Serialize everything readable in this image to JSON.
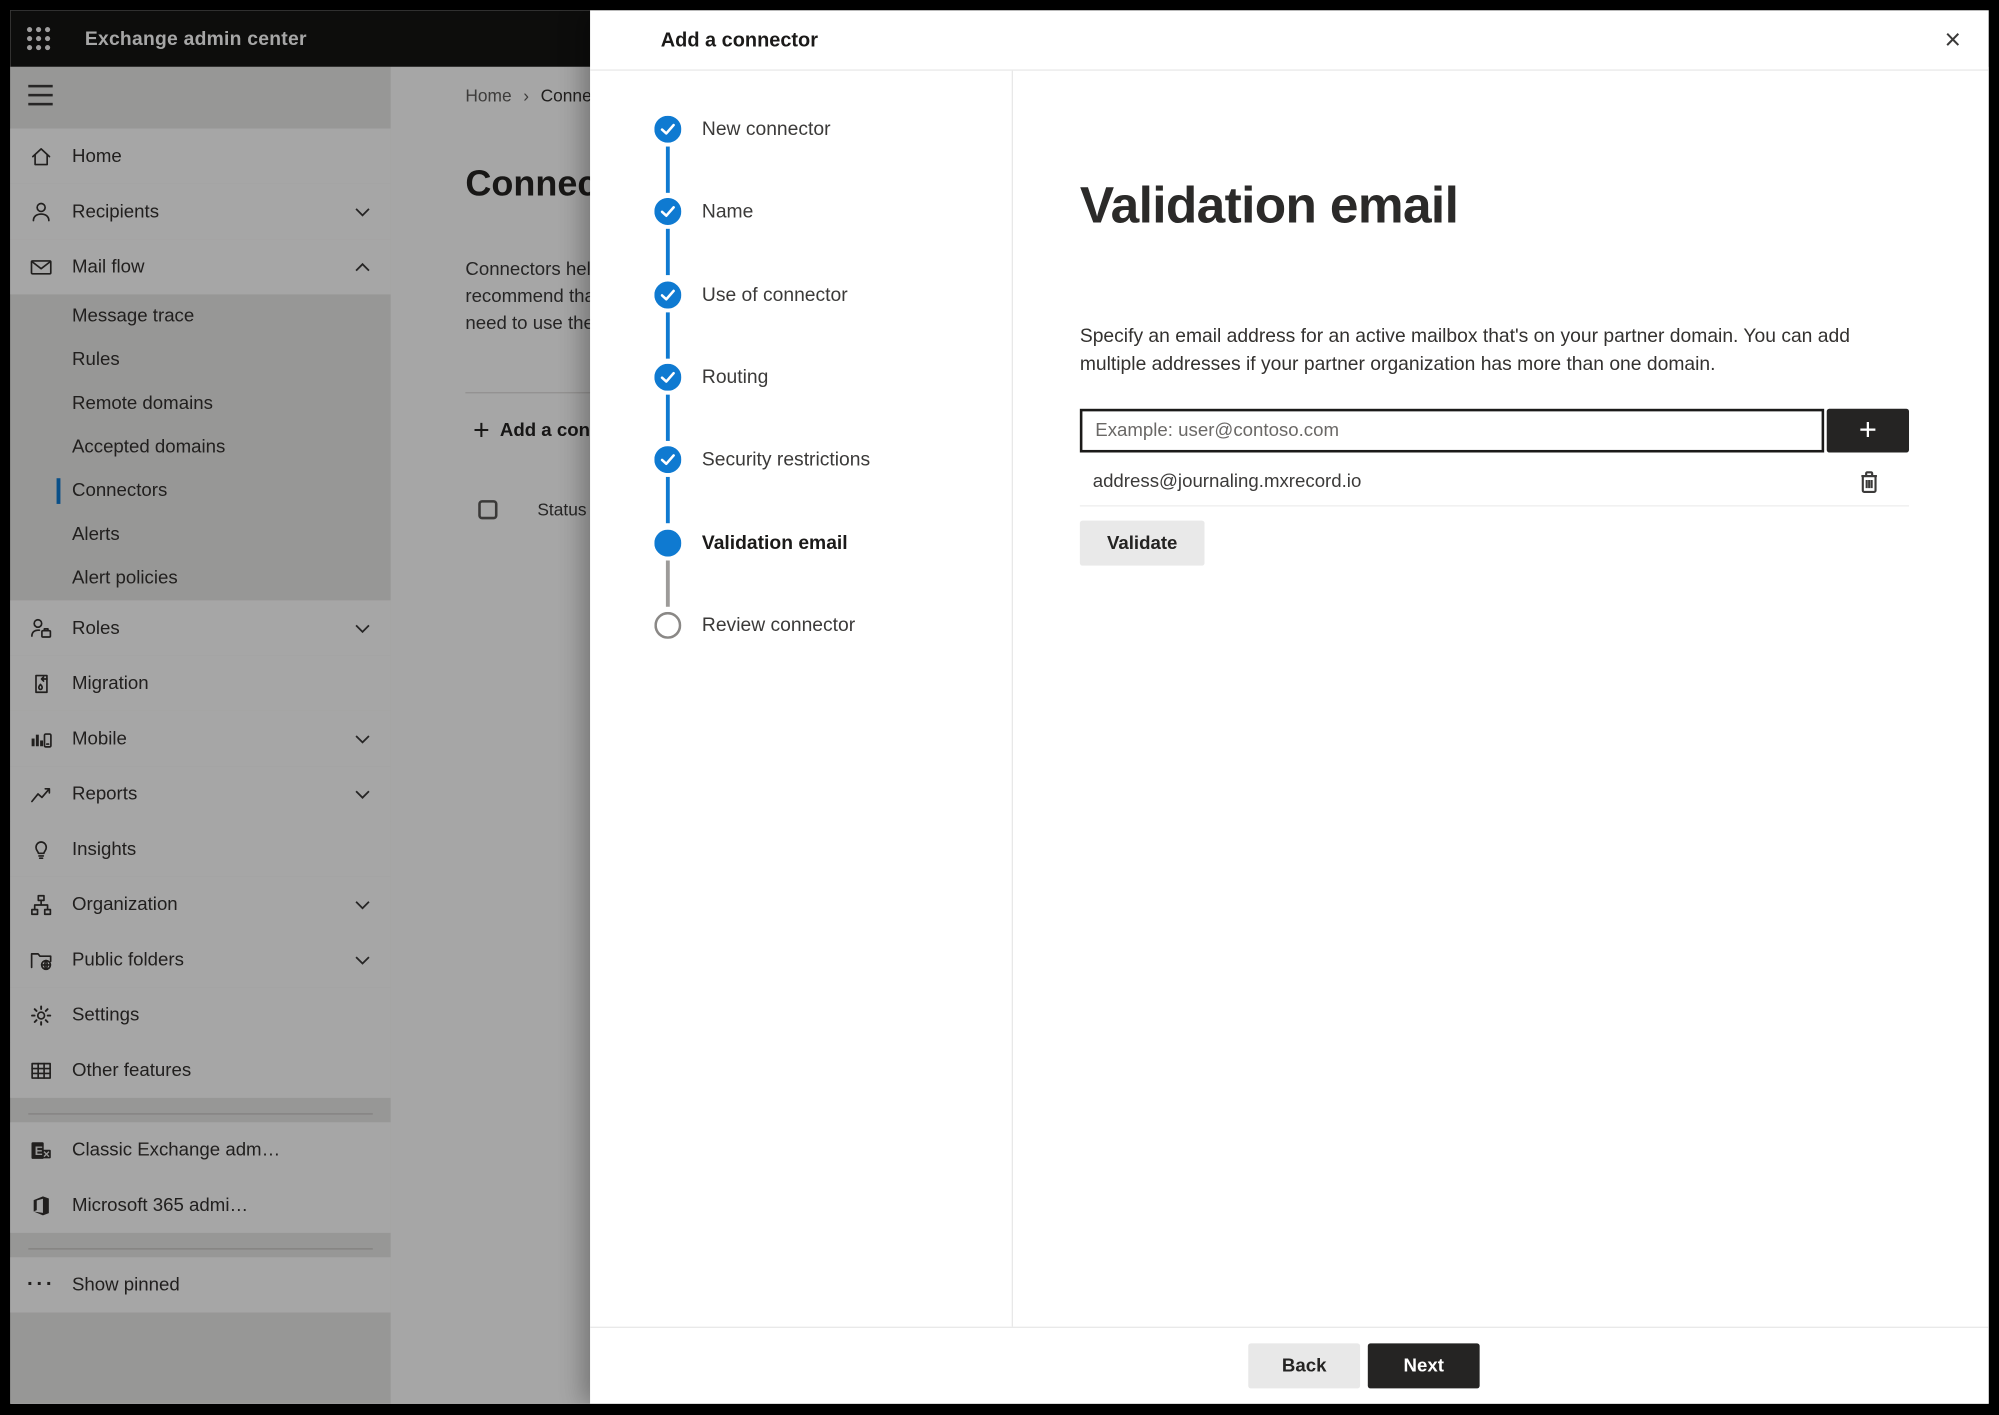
{
  "topbar": {
    "app_title": "Exchange admin center",
    "waffle_icon": "app-launcher-icon"
  },
  "sidebar": {
    "items": [
      {
        "label": "Home",
        "icon": "home-icon",
        "type": "main"
      },
      {
        "label": "Recipients",
        "icon": "person-icon",
        "type": "main",
        "chevron": "down"
      },
      {
        "label": "Mail flow",
        "icon": "mail-icon",
        "type": "main",
        "chevron": "up",
        "expanded": true
      },
      {
        "label": "Message trace",
        "type": "sub"
      },
      {
        "label": "Rules",
        "type": "sub"
      },
      {
        "label": "Remote domains",
        "type": "sub"
      },
      {
        "label": "Accepted domains",
        "type": "sub"
      },
      {
        "label": "Connectors",
        "type": "sub",
        "selected": true
      },
      {
        "label": "Alerts",
        "type": "sub"
      },
      {
        "label": "Alert policies",
        "type": "sub"
      },
      {
        "label": "Roles",
        "icon": "roles-icon",
        "type": "main",
        "chevron": "down"
      },
      {
        "label": "Migration",
        "icon": "migration-icon",
        "type": "main"
      },
      {
        "label": "Mobile",
        "icon": "mobile-icon",
        "type": "main",
        "chevron": "down"
      },
      {
        "label": "Reports",
        "icon": "reports-icon",
        "type": "main",
        "chevron": "down"
      },
      {
        "label": "Insights",
        "icon": "insights-icon",
        "type": "main"
      },
      {
        "label": "Organization",
        "icon": "organization-icon",
        "type": "main",
        "chevron": "down"
      },
      {
        "label": "Public folders",
        "icon": "public-folders-icon",
        "type": "main",
        "chevron": "down"
      },
      {
        "label": "Settings",
        "icon": "gear-icon",
        "type": "main"
      },
      {
        "label": "Other features",
        "icon": "grid-icon",
        "type": "main"
      },
      {
        "label": "Classic Exchange adm…",
        "icon": "exchange-logo-icon",
        "type": "main"
      },
      {
        "label": "Microsoft 365 admi…",
        "icon": "office-logo-icon",
        "type": "main"
      },
      {
        "label": "Show pinned",
        "icon": "ellipsis-icon",
        "type": "main"
      }
    ]
  },
  "background_page": {
    "breadcrumb": {
      "home": "Home",
      "separator": "›",
      "current": "Conne"
    },
    "title": "Connec",
    "description_lines": [
      "Connectors help",
      "recommend that",
      "need to use ther"
    ],
    "add_button_label": "Add a conn",
    "table_header_status": "Status"
  },
  "modal": {
    "title": "Add a connector",
    "close_icon": "×",
    "steps": [
      {
        "label": "New connector",
        "state": "completed"
      },
      {
        "label": "Name",
        "state": "completed"
      },
      {
        "label": "Use of connector",
        "state": "completed"
      },
      {
        "label": "Routing",
        "state": "completed"
      },
      {
        "label": "Security restrictions",
        "state": "completed"
      },
      {
        "label": "Validation email",
        "state": "current"
      },
      {
        "label": "Review connector",
        "state": "upcoming"
      }
    ],
    "content": {
      "heading": "Validation email",
      "description_line1": "Specify an email address for an active mailbox that's on your partner domain. You can add",
      "description_line2": "multiple addresses if your partner organization has more than one domain.",
      "email_input": {
        "placeholder": "Example: user@contoso.com",
        "value": ""
      },
      "add_address_label": "+",
      "addresses": [
        "address@journaling.mxrecord.io"
      ],
      "validate_label": "Validate"
    },
    "footer": {
      "back_label": "Back",
      "next_label": "Next"
    }
  },
  "colors": {
    "accent": "#0f7ad1",
    "topbar_bg": "#151413",
    "dark_button": "#252423",
    "sidebar_bg": "#e9e8e7"
  }
}
